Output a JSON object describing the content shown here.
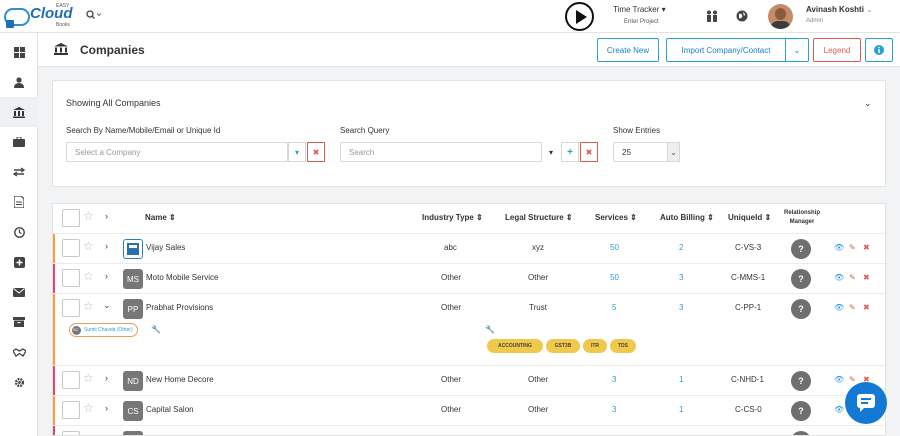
{
  "header": {
    "logo_easy": "EASY",
    "logo_word": "Cloud",
    "logo_books": "Books",
    "time_tracker": "Time Tracker",
    "project": "Enter Project",
    "user_name": "Avinash Koshti",
    "user_role": "Admin"
  },
  "page": {
    "title": "Companies",
    "buttons": {
      "create": "Create New",
      "import": "Import Company/Contact",
      "legend": "Legend"
    }
  },
  "filters": {
    "showing": "Showing All Companies",
    "search_label": "Search By Name/Mobile/Email or Unique Id",
    "company_placeholder": "Select a Company",
    "query_label": "Search Query",
    "query_placeholder": "Search",
    "entries_label": "Show Entries",
    "entries_value": "25"
  },
  "table": {
    "headers": {
      "name": "Name",
      "industry": "Industry Type",
      "legal": "Legal Structure",
      "services": "Services",
      "auto_billing": "Auto Billing",
      "unique": "UniqueId",
      "rm": "Relationship Manager"
    },
    "rows": [
      {
        "initials": "",
        "name": "Vijay Sales",
        "industry": "abc",
        "legal": "xyz",
        "services": "50",
        "auto": "2",
        "uid": "C-VS-3",
        "rm": "?",
        "color": "#f0a33a"
      },
      {
        "initials": "MS",
        "name": "Moto Mobile Service",
        "industry": "Other",
        "legal": "Other",
        "services": "50",
        "auto": "3",
        "uid": "C-MMS-1",
        "rm": "?",
        "color": "#e0446a"
      },
      {
        "initials": "PP",
        "name": "Prabhat Provisions",
        "industry": "Other",
        "legal": "Trust",
        "services": "5",
        "auto": "3",
        "uid": "C-PP-1",
        "rm": "?",
        "color": "#f0a33a"
      },
      {
        "initials": "ND",
        "name": "New Home Decore",
        "industry": "Other",
        "legal": "Other",
        "services": "3",
        "auto": "1",
        "uid": "C-NHD-1",
        "rm": "?",
        "color": "#e0446a"
      },
      {
        "initials": "CS",
        "name": "Capital Salon",
        "industry": "Other",
        "legal": "Other",
        "services": "3",
        "auto": "1",
        "uid": "C-CS-0",
        "rm": "?",
        "color": "#f0a33a"
      }
    ],
    "expanded": {
      "contact_initials": "SC",
      "contact": "Sumit Chavda (Other)",
      "tags": [
        "ACCOUNTING",
        "GST3B",
        "ITR",
        "TDS"
      ]
    }
  },
  "colors": {
    "accent": "#2a9fd6",
    "danger": "#e05a4e",
    "tag": "#f0c84a"
  }
}
